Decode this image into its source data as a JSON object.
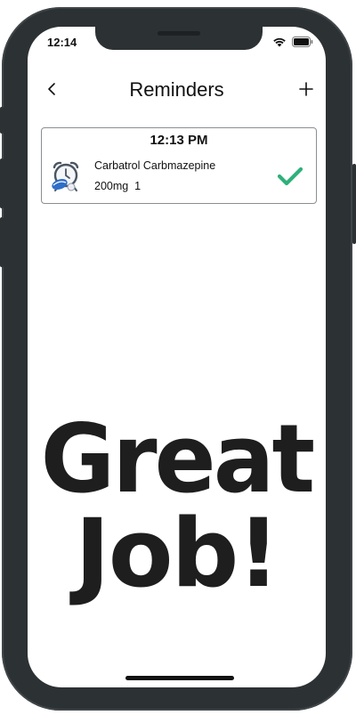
{
  "status_bar": {
    "time": "12:14",
    "icons": [
      "wifi-icon",
      "battery-icon"
    ]
  },
  "nav": {
    "back_icon": "chevron-left-icon",
    "title": "Reminders",
    "add_icon": "plus-icon"
  },
  "reminder": {
    "time": "12:13 PM",
    "icon": "alarm-clock-pill-icon",
    "medication": "Carbatrol Carbmazepine",
    "dose": "200mg  1",
    "status_icon": "checkmark-icon",
    "status_color": "#2fb07a"
  },
  "message": {
    "line1": "Great",
    "line2": "Job!"
  }
}
